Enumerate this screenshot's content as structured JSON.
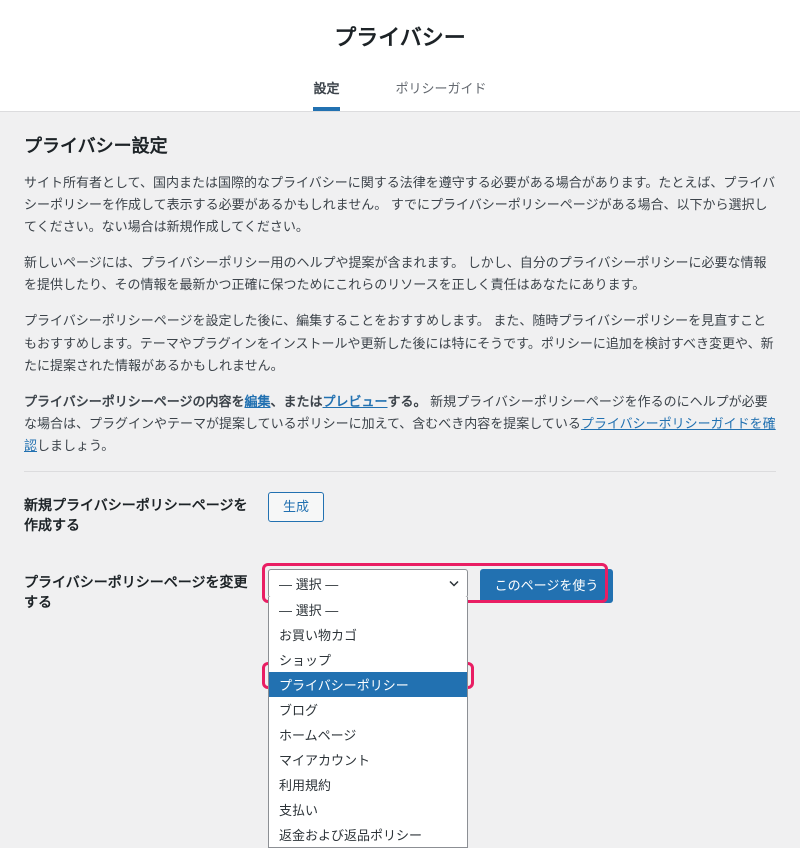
{
  "page_title": "プライバシー",
  "tabs": {
    "settings": "設定",
    "guide": "ポリシーガイド"
  },
  "section_title": "プライバシー設定",
  "paragraphs": {
    "p1": "サイト所有者として、国内または国際的なプライバシーに関する法律を遵守する必要がある場合があります。たとえば、プライバシーポリシーを作成して表示する必要があるかもしれません。 すでにプライバシーポリシーページがある場合、以下から選択してください。ない場合は新規作成してください。",
    "p2": "新しいページには、プライバシーポリシー用のヘルプや提案が含まれます。 しかし、自分のプライバシーポリシーに必要な情報を提供したり、その情報を最新かつ正確に保つためにこれらのリソースを正しく責任はあなたにあります。",
    "p3": "プライバシーポリシーページを設定した後に、編集することをおすすめします。 また、随時プライバシーポリシーを見直すこともおすすめします。テーマやプラグインをインストールや更新した後には特にそうです。ポリシーに追加を検討すべき変更や、新たに提案された情報があるかもしれません。",
    "p4_pre": "プライバシーポリシーページの内容を",
    "p4_edit": "編集",
    "p4_mid1": "、または",
    "p4_preview": "プレビュー",
    "p4_mid2": "する。",
    "p4_after": "新規プライバシーポリシーページを作るのにヘルプが必要な場合は、プラグインやテーマが提案しているポリシーに加えて、含むべき内容を提案している",
    "p4_link": "プライバシーポリシーガイドを確認",
    "p4_end": "しましょう。"
  },
  "form": {
    "create_label": "新規プライバシーポリシーページを作成する",
    "create_btn": "生成",
    "change_label": "プライバシーポリシーページを変更する",
    "select_placeholder": "— 選択 —",
    "use_btn": "このページを使う",
    "options": [
      "— 選択 —",
      "お買い物カゴ",
      "ショップ",
      "プライバシーポリシー",
      "ブログ",
      "ホームページ",
      "マイアカウント",
      "利用規約",
      "支払い",
      "返金および返品ポリシー"
    ]
  }
}
